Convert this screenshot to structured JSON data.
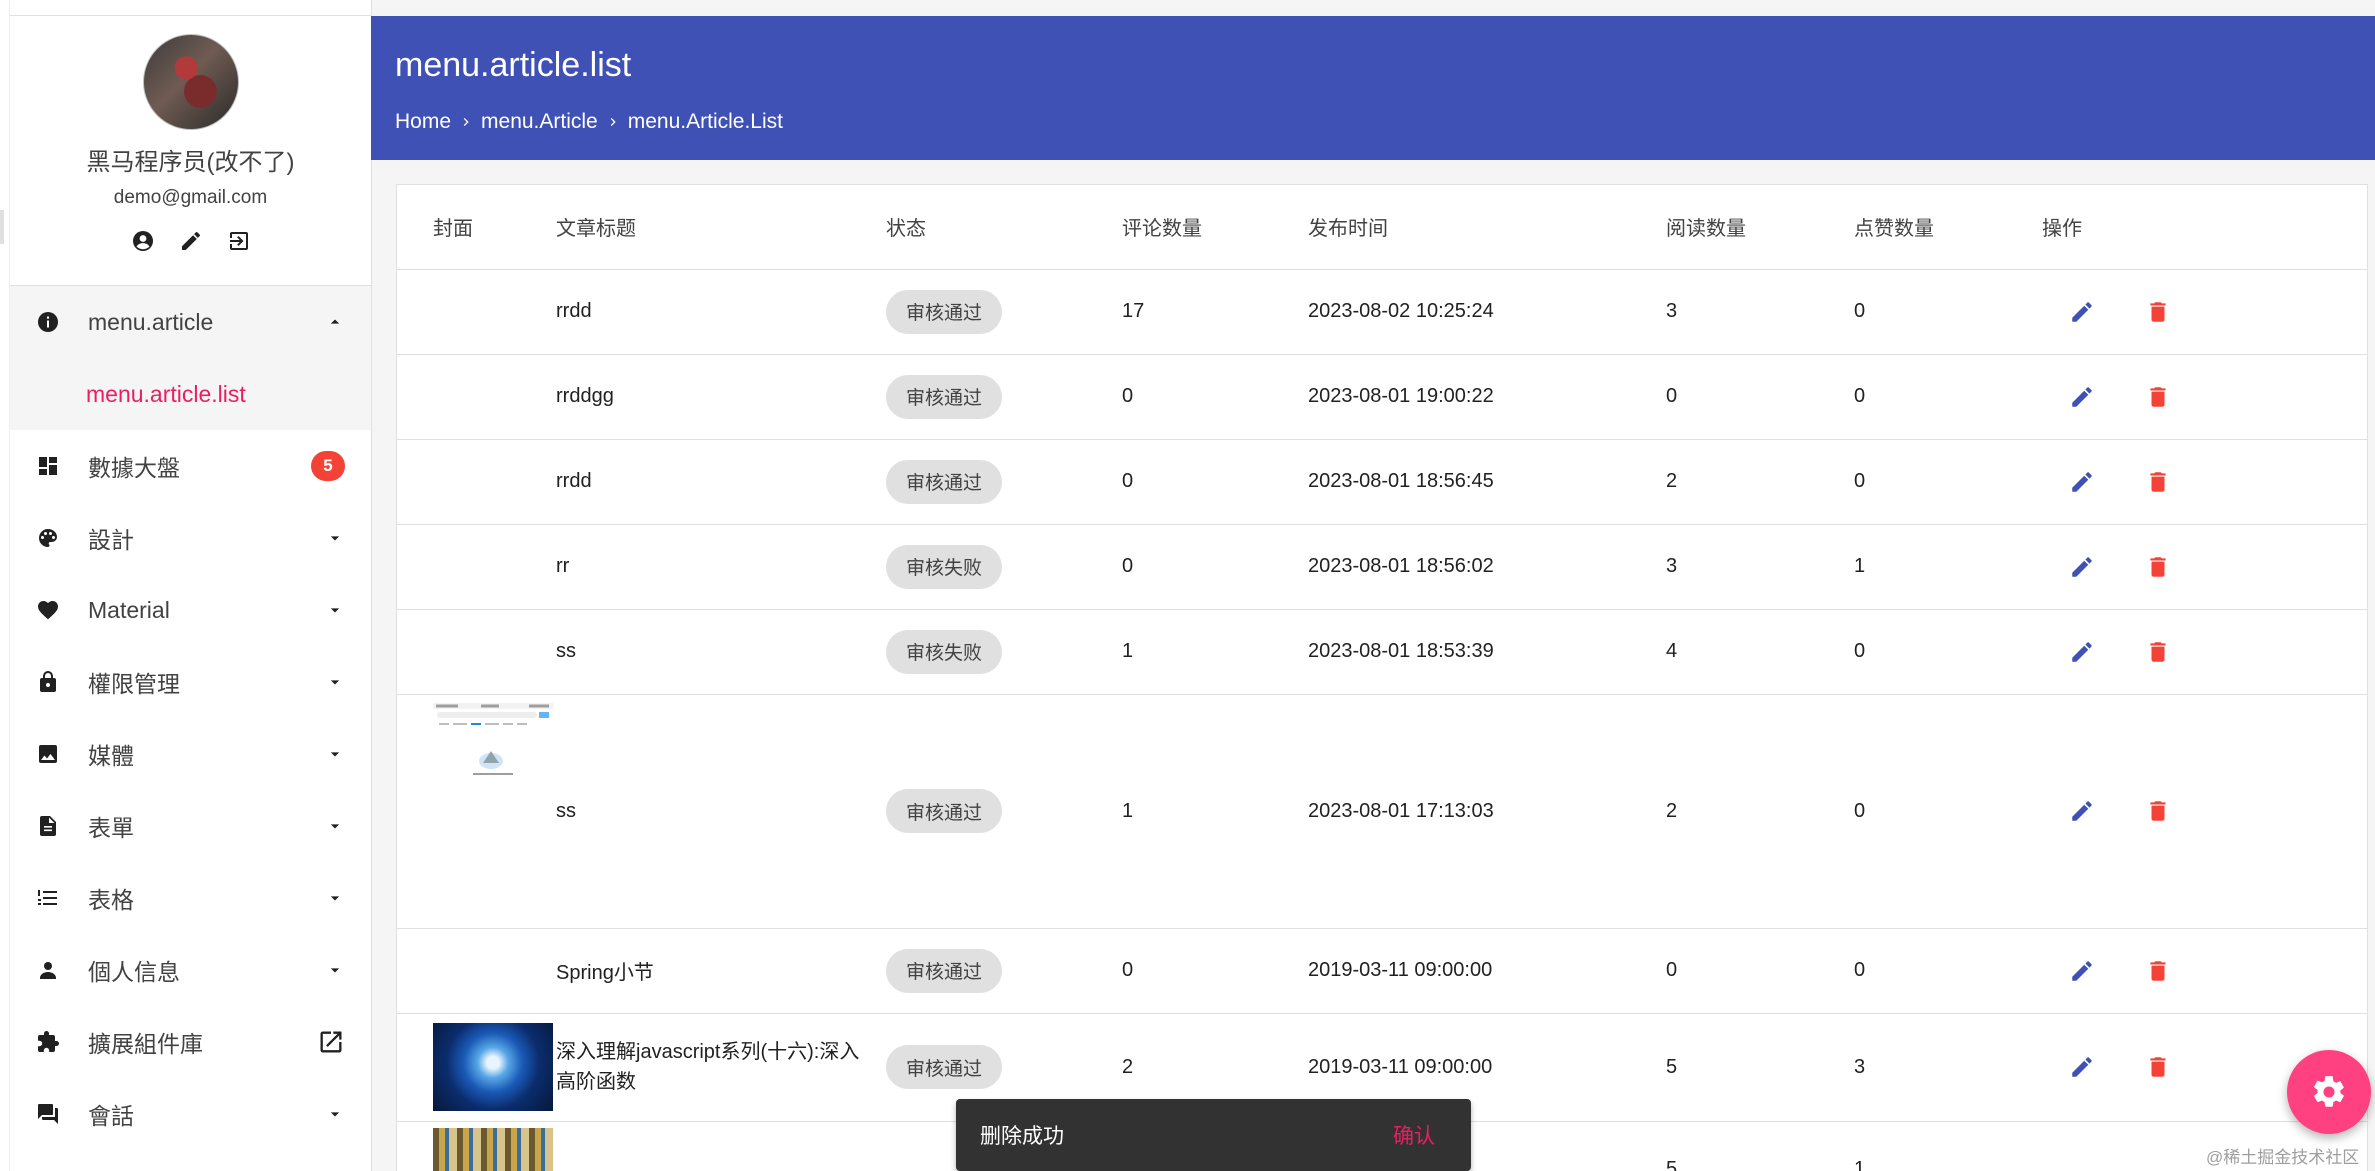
{
  "profile": {
    "name": "黑马程序员(改不了)",
    "email": "demo@gmail.com",
    "actions": [
      "account-circle-icon",
      "pencil-icon",
      "logout-icon"
    ]
  },
  "menu": {
    "group_article": {
      "label": "menu.article",
      "icon": "info-icon",
      "expanded": true
    },
    "sub_article_list": {
      "label": "menu.article.list"
    },
    "items": [
      {
        "label": "數據大盤",
        "icon": "dashboard-icon",
        "badge": "5"
      },
      {
        "label": "設計",
        "icon": "palette-icon"
      },
      {
        "label": "Material",
        "icon": "heart-icon"
      },
      {
        "label": "權限管理",
        "icon": "lock-icon"
      },
      {
        "label": "媒體",
        "icon": "image-icon"
      },
      {
        "label": "表單",
        "icon": "document-icon"
      },
      {
        "label": "表格",
        "icon": "list-numbered-icon"
      },
      {
        "label": "個人信息",
        "icon": "person-icon"
      },
      {
        "label": "擴展組件庫",
        "icon": "puzzle-icon",
        "right_icon": "open-in-new-icon"
      },
      {
        "label": "會話",
        "icon": "forum-icon"
      }
    ]
  },
  "header": {
    "title": "menu.article.list",
    "breadcrumb": [
      "Home",
      "menu.Article",
      "menu.Article.List"
    ],
    "color": "#3f51b5"
  },
  "table": {
    "columns": [
      "封面",
      "文章标题",
      "状态",
      "评论数量",
      "发布时间",
      "阅读数量",
      "点赞数量",
      "操作"
    ],
    "rows": [
      {
        "cover": "",
        "title": "rrdd",
        "status": "审核通过",
        "comments": "17",
        "time": "2023-08-02 10:25:24",
        "reads": "3",
        "likes": "0"
      },
      {
        "cover": "",
        "title": "rrddgg",
        "status": "审核通过",
        "comments": "0",
        "time": "2023-08-01 19:00:22",
        "reads": "0",
        "likes": "0"
      },
      {
        "cover": "",
        "title": "rrdd",
        "status": "审核通过",
        "comments": "0",
        "time": "2023-08-01 18:56:45",
        "reads": "2",
        "likes": "0"
      },
      {
        "cover": "",
        "title": "rr",
        "status": "审核失败",
        "comments": "0",
        "time": "2023-08-01 18:56:02",
        "reads": "3",
        "likes": "1"
      },
      {
        "cover": "",
        "title": "ss",
        "status": "审核失败",
        "comments": "1",
        "time": "2023-08-01 18:53:39",
        "reads": "4",
        "likes": "0"
      },
      {
        "cover": "phone-screenshot",
        "title": "ss",
        "status": "审核通过",
        "comments": "1",
        "time": "2023-08-01 17:13:03",
        "reads": "2",
        "likes": "0"
      },
      {
        "cover": "",
        "title": "Spring小节",
        "status": "审核通过",
        "comments": "0",
        "time": "2019-03-11 09:00:00",
        "reads": "0",
        "likes": "0"
      },
      {
        "cover": "globe-in-hands",
        "title": "深入理解javascript系列(十六):深入高阶函数",
        "status": "审核通过",
        "comments": "2",
        "time": "2019-03-11 09:00:00",
        "reads": "5",
        "likes": "3"
      },
      {
        "cover": "colorful-map",
        "title": "",
        "status": "",
        "comments": "",
        "time": "",
        "reads": "5",
        "likes": "1"
      }
    ]
  },
  "colors": {
    "edit": "#3f51b5",
    "delete": "#f44336",
    "accent": "#e91e63",
    "fab": "#ff4081"
  },
  "snackbar": {
    "message": "删除成功",
    "action": "确认"
  },
  "watermark": "@稀土掘金技术社区"
}
